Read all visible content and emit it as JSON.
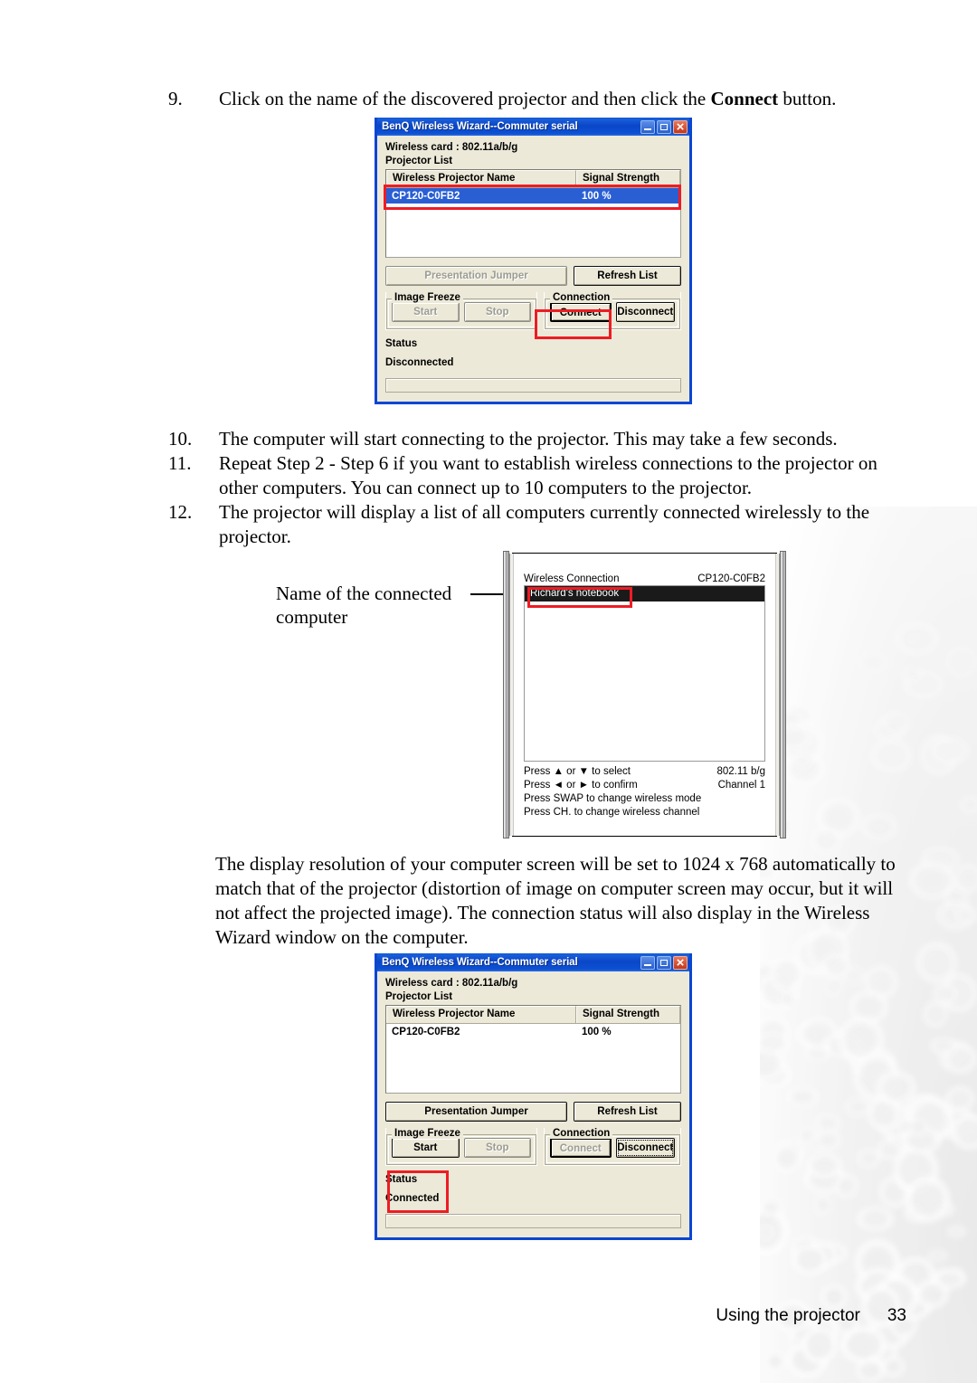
{
  "steps": [
    {
      "num": "9.",
      "text_before": "Click on the name of the discovered projector and then click the ",
      "bold": "Connect",
      "text_after": " button."
    },
    {
      "num": "10.",
      "text": "The computer will start connecting to the projector. This may take a few seconds."
    },
    {
      "num": "11.",
      "text": "Repeat Step 2 - Step 6 if you want to establish wireless connections to the projector on other computers. You can connect up to 10 computers to the projector."
    },
    {
      "num": "12.",
      "text": "The projector will display a list of all computers currently connected wirelessly to the projector."
    }
  ],
  "callout": {
    "line1": "Name of the connected",
    "line2": "computer"
  },
  "body_paragraph": "The display resolution of your computer screen will be set to 1024 x 768 automatically to match that of the projector (distortion of image on computer screen may occur, but it will not affect the projected image). The connection status will also display in the Wireless Wizard window on the computer.",
  "dialog1": {
    "title": "BenQ Wireless Wizard--Commuter serial",
    "wireless_card_label": "Wireless card :  802.11a/b/g",
    "projector_list_label": "Projector List",
    "columns": [
      "Wireless Projector Name",
      "Signal Strength"
    ],
    "rows": [
      {
        "name": "CP120-C0FB2",
        "signal": "100 %"
      }
    ],
    "presentation_jumper": "Presentation Jumper",
    "refresh_list": "Refresh List",
    "image_freeze_legend": "Image Freeze",
    "connection_legend": "Connection",
    "start": "Start",
    "stop": "Stop",
    "connect": "Connect",
    "disconnect": "Disconnect",
    "status_label": "Status",
    "status_value": "Disconnected"
  },
  "dialog2": {
    "title": "BenQ Wireless Wizard--Commuter serial",
    "wireless_card_label": "Wireless card :  802.11a/b/g",
    "projector_list_label": "Projector List",
    "columns": [
      "Wireless Projector Name",
      "Signal Strength"
    ],
    "rows": [
      {
        "name": "CP120-C0FB2",
        "signal": "100 %"
      }
    ],
    "presentation_jumper": "Presentation Jumper",
    "refresh_list": "Refresh List",
    "image_freeze_legend": "Image Freeze",
    "connection_legend": "Connection",
    "start": "Start",
    "stop": "Stop",
    "connect": "Connect",
    "disconnect": "Disconnect",
    "status_label": "Status",
    "status_value": "Connected"
  },
  "projector_osd": {
    "header_left": "Wireless Connection",
    "header_right": "CP120-C0FB2",
    "items": [
      "Richard's notebook"
    ],
    "hints": [
      {
        "left": "Press ▲ or ▼ to select",
        "right": "802.11 b/g"
      },
      {
        "left": "Press ◄ or ► to confirm",
        "right": "Channel 1"
      },
      {
        "left": "Press SWAP to change wireless mode",
        "right": ""
      },
      {
        "left": "Press CH. to change wireless channel",
        "right": ""
      }
    ]
  },
  "footer": {
    "label": "Using the projector",
    "page": "33"
  },
  "colors": {
    "annotation_red": "#EE1C24",
    "titlebar_blue": "#0A46C8",
    "selection_blue": "#2A5FD4",
    "dialog_face": "#ECE9D8"
  }
}
